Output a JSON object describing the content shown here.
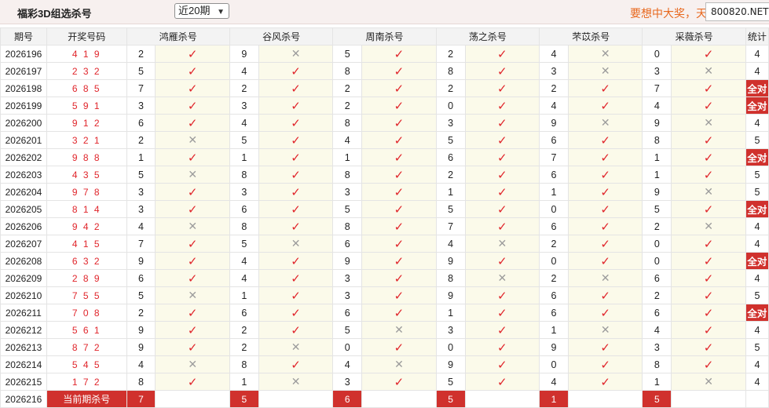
{
  "header": {
    "title": "福彩3D组选杀号",
    "period_select": "近20期",
    "slogan": "要想中大奖，天",
    "watermark": "800820.NET"
  },
  "columns": {
    "issue": "期号",
    "numbers": "开奖号码",
    "experts": [
      "鸿雁杀号",
      "谷风杀号",
      "周南杀号",
      "荡之杀号",
      "芣苡杀号",
      "采薇杀号"
    ],
    "stat": "统计"
  },
  "rows": [
    {
      "issue": "2026196",
      "nums": "4 1 9",
      "kills": [
        [
          "2",
          "hit"
        ],
        [
          "9",
          "miss"
        ],
        [
          "5",
          "hit"
        ],
        [
          "2",
          "hit"
        ],
        [
          "4",
          "miss"
        ],
        [
          "0",
          "hit"
        ]
      ],
      "stat": "4"
    },
    {
      "issue": "2026197",
      "nums": "2 3 2",
      "kills": [
        [
          "5",
          "hit"
        ],
        [
          "4",
          "hit"
        ],
        [
          "8",
          "hit"
        ],
        [
          "8",
          "hit"
        ],
        [
          "3",
          "miss"
        ],
        [
          "3",
          "miss"
        ]
      ],
      "stat": "4"
    },
    {
      "issue": "2026198",
      "nums": "6 8 5",
      "kills": [
        [
          "7",
          "hit"
        ],
        [
          "2",
          "hit"
        ],
        [
          "2",
          "hit"
        ],
        [
          "2",
          "hit"
        ],
        [
          "2",
          "hit"
        ],
        [
          "7",
          "hit"
        ]
      ],
      "stat": "全对"
    },
    {
      "issue": "2026199",
      "nums": "5 9 1",
      "kills": [
        [
          "3",
          "hit"
        ],
        [
          "3",
          "hit"
        ],
        [
          "2",
          "hit"
        ],
        [
          "0",
          "hit"
        ],
        [
          "4",
          "hit"
        ],
        [
          "4",
          "hit"
        ]
      ],
      "stat": "全对"
    },
    {
      "issue": "2026200",
      "nums": "9 1 2",
      "kills": [
        [
          "6",
          "hit"
        ],
        [
          "4",
          "hit"
        ],
        [
          "8",
          "hit"
        ],
        [
          "3",
          "hit"
        ],
        [
          "9",
          "miss"
        ],
        [
          "9",
          "miss"
        ]
      ],
      "stat": "4"
    },
    {
      "issue": "2026201",
      "nums": "3 2 1",
      "kills": [
        [
          "2",
          "miss"
        ],
        [
          "5",
          "hit"
        ],
        [
          "4",
          "hit"
        ],
        [
          "5",
          "hit"
        ],
        [
          "6",
          "hit"
        ],
        [
          "8",
          "hit"
        ]
      ],
      "stat": "5"
    },
    {
      "issue": "2026202",
      "nums": "9 8 8",
      "kills": [
        [
          "1",
          "hit"
        ],
        [
          "1",
          "hit"
        ],
        [
          "1",
          "hit"
        ],
        [
          "6",
          "hit"
        ],
        [
          "7",
          "hit"
        ],
        [
          "1",
          "hit"
        ]
      ],
      "stat": "全对"
    },
    {
      "issue": "2026203",
      "nums": "4 3 5",
      "kills": [
        [
          "5",
          "miss"
        ],
        [
          "8",
          "hit"
        ],
        [
          "8",
          "hit"
        ],
        [
          "2",
          "hit"
        ],
        [
          "6",
          "hit"
        ],
        [
          "1",
          "hit"
        ]
      ],
      "stat": "5"
    },
    {
      "issue": "2026204",
      "nums": "9 7 8",
      "kills": [
        [
          "3",
          "hit"
        ],
        [
          "3",
          "hit"
        ],
        [
          "3",
          "hit"
        ],
        [
          "1",
          "hit"
        ],
        [
          "1",
          "hit"
        ],
        [
          "9",
          "miss"
        ]
      ],
      "stat": "5"
    },
    {
      "issue": "2026205",
      "nums": "8 1 4",
      "kills": [
        [
          "3",
          "hit"
        ],
        [
          "6",
          "hit"
        ],
        [
          "5",
          "hit"
        ],
        [
          "5",
          "hit"
        ],
        [
          "0",
          "hit"
        ],
        [
          "5",
          "hit"
        ]
      ],
      "stat": "全对"
    },
    {
      "issue": "2026206",
      "nums": "9 4 2",
      "kills": [
        [
          "4",
          "miss"
        ],
        [
          "8",
          "hit"
        ],
        [
          "8",
          "hit"
        ],
        [
          "7",
          "hit"
        ],
        [
          "6",
          "hit"
        ],
        [
          "2",
          "miss"
        ]
      ],
      "stat": "4"
    },
    {
      "issue": "2026207",
      "nums": "4 1 5",
      "kills": [
        [
          "7",
          "hit"
        ],
        [
          "5",
          "miss"
        ],
        [
          "6",
          "hit"
        ],
        [
          "4",
          "miss"
        ],
        [
          "2",
          "hit"
        ],
        [
          "0",
          "hit"
        ]
      ],
      "stat": "4"
    },
    {
      "issue": "2026208",
      "nums": "6 3 2",
      "kills": [
        [
          "9",
          "hit"
        ],
        [
          "4",
          "hit"
        ],
        [
          "9",
          "hit"
        ],
        [
          "9",
          "hit"
        ],
        [
          "0",
          "hit"
        ],
        [
          "0",
          "hit"
        ]
      ],
      "stat": "全对"
    },
    {
      "issue": "2026209",
      "nums": "2 8 9",
      "kills": [
        [
          "6",
          "hit"
        ],
        [
          "4",
          "hit"
        ],
        [
          "3",
          "hit"
        ],
        [
          "8",
          "miss"
        ],
        [
          "2",
          "miss"
        ],
        [
          "6",
          "hit"
        ]
      ],
      "stat": "4"
    },
    {
      "issue": "2026210",
      "nums": "7 5 5",
      "kills": [
        [
          "5",
          "miss"
        ],
        [
          "1",
          "hit"
        ],
        [
          "3",
          "hit"
        ],
        [
          "9",
          "hit"
        ],
        [
          "6",
          "hit"
        ],
        [
          "2",
          "hit"
        ]
      ],
      "stat": "5"
    },
    {
      "issue": "2026211",
      "nums": "7 0 8",
      "kills": [
        [
          "2",
          "hit"
        ],
        [
          "6",
          "hit"
        ],
        [
          "6",
          "hit"
        ],
        [
          "1",
          "hit"
        ],
        [
          "6",
          "hit"
        ],
        [
          "6",
          "hit"
        ]
      ],
      "stat": "全对"
    },
    {
      "issue": "2026212",
      "nums": "5 6 1",
      "kills": [
        [
          "9",
          "hit"
        ],
        [
          "2",
          "hit"
        ],
        [
          "5",
          "miss"
        ],
        [
          "3",
          "hit"
        ],
        [
          "1",
          "miss"
        ],
        [
          "4",
          "hit"
        ]
      ],
      "stat": "4"
    },
    {
      "issue": "2026213",
      "nums": "8 7 2",
      "kills": [
        [
          "9",
          "hit"
        ],
        [
          "2",
          "miss"
        ],
        [
          "0",
          "hit"
        ],
        [
          "0",
          "hit"
        ],
        [
          "9",
          "hit"
        ],
        [
          "3",
          "hit"
        ]
      ],
      "stat": "5"
    },
    {
      "issue": "2026214",
      "nums": "5 4 5",
      "kills": [
        [
          "4",
          "miss"
        ],
        [
          "8",
          "hit"
        ],
        [
          "4",
          "miss"
        ],
        [
          "9",
          "hit"
        ],
        [
          "0",
          "hit"
        ],
        [
          "8",
          "hit"
        ]
      ],
      "stat": "4"
    },
    {
      "issue": "2026215",
      "nums": "1 7 2",
      "kills": [
        [
          "8",
          "hit"
        ],
        [
          "1",
          "miss"
        ],
        [
          "3",
          "hit"
        ],
        [
          "5",
          "hit"
        ],
        [
          "4",
          "hit"
        ],
        [
          "1",
          "miss"
        ]
      ],
      "stat": "4"
    }
  ],
  "current": {
    "issue": "2026216",
    "label": "当前期杀号",
    "kills": [
      "7",
      "5",
      "6",
      "5",
      "1",
      "5"
    ]
  },
  "symbols": {
    "hit": "✓",
    "miss": "✕"
  },
  "colors": {
    "accent": "#d0312d",
    "hit": "#e0252b",
    "miss": "#9c9c9c",
    "result_bg": "#fbfaea",
    "slogan": "#e8681e"
  }
}
